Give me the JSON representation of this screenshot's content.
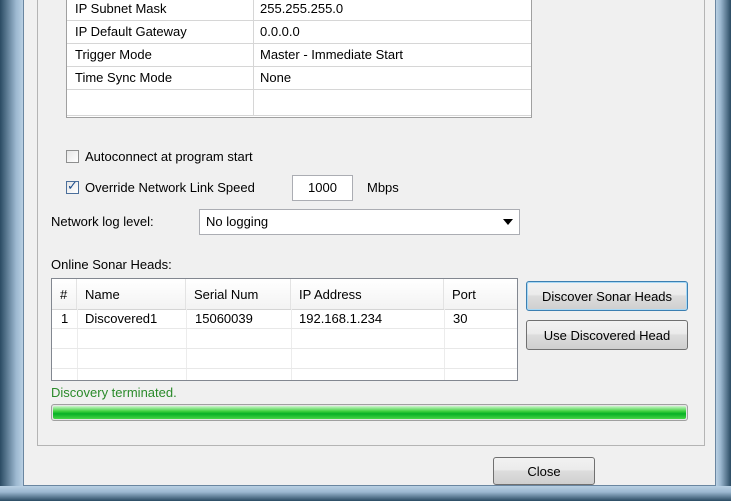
{
  "properties": [
    {
      "key": "IP Subnet Mask",
      "value": "255.255.255.0"
    },
    {
      "key": "IP Default Gateway",
      "value": "0.0.0.0"
    },
    {
      "key": "Trigger Mode",
      "value": "Master - Immediate Start"
    },
    {
      "key": "Time Sync Mode",
      "value": "None"
    },
    {
      "key": "",
      "value": ""
    }
  ],
  "options": {
    "autoconnect_label": "Autoconnect at program start",
    "autoconnect_checked": false,
    "override_label": "Override Network Link Speed",
    "override_checked": true,
    "link_speed_value": "1000",
    "link_speed_unit": "Mbps",
    "log_level_label": "Network log level:",
    "log_level_value": "No logging"
  },
  "online_heads": {
    "label": "Online Sonar Heads:",
    "columns": [
      "#",
      "Name",
      "Serial Num",
      "IP Address",
      "Port"
    ],
    "rows": [
      {
        "num": "1",
        "name": "Discovered1",
        "serial": "15060039",
        "ip": "192.168.1.234",
        "port": "30"
      }
    ]
  },
  "buttons": {
    "discover": "Discover Sonar Heads",
    "use_discovered": "Use Discovered Head",
    "close": "Close"
  },
  "status": {
    "text": "Discovery terminated.",
    "progress": 1.0,
    "progress_color": "#06b025"
  },
  "icons": {
    "dropdown": "chevron-down-icon",
    "check": "checkmark-icon"
  }
}
